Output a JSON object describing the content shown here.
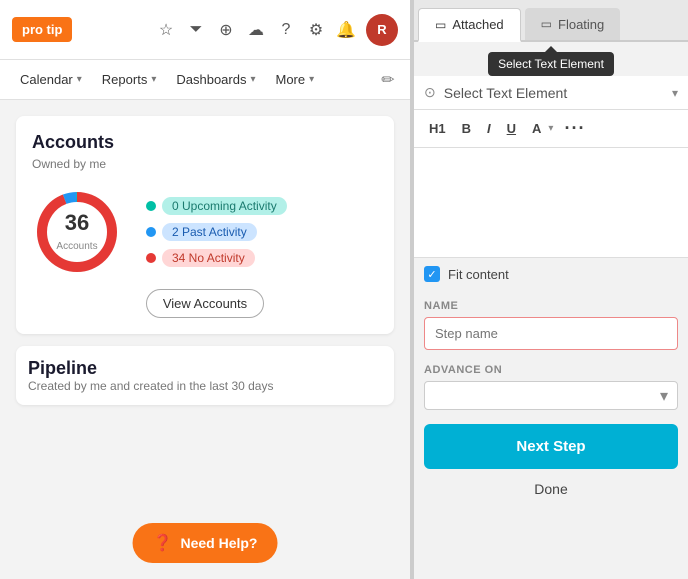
{
  "left": {
    "pro_tip_label": "pro tip",
    "nav_items": [
      {
        "label": "Calendar",
        "id": "calendar"
      },
      {
        "label": "Reports",
        "id": "reports"
      },
      {
        "label": "Dashboards",
        "id": "dashboards"
      },
      {
        "label": "More",
        "id": "more"
      }
    ],
    "accounts": {
      "title": "Accounts",
      "subtitle": "Owned by me",
      "count": "36",
      "count_label": "Accounts",
      "legend": [
        {
          "color": "#00bfa5",
          "badge_class": "badge-teal",
          "text": "0 Upcoming Activity"
        },
        {
          "color": "#2196f3",
          "badge_class": "badge-blue",
          "text": "2 Past Activity"
        },
        {
          "color": "#e53935",
          "badge_class": "badge-red",
          "text": "34 No Activity"
        }
      ],
      "view_accounts_label": "View Accounts"
    },
    "pipeline": {
      "title": "Pipeline",
      "subtitle": "Created by me and created in the last 30 days"
    },
    "need_help_label": "Need Help?"
  },
  "right": {
    "tabs": [
      {
        "label": "Attached",
        "id": "attached",
        "active": true,
        "icon": "▭"
      },
      {
        "label": "Floating",
        "id": "floating",
        "active": false,
        "icon": "▭"
      }
    ],
    "tooltip_text": "Select Text Element",
    "select_placeholder": "Select Text Element",
    "format": {
      "h1": "H1",
      "bold": "B",
      "italic": "I",
      "underline": "U",
      "color": "A",
      "more": "···"
    },
    "fit_content_label": "Fit content",
    "name_label": "NAME",
    "step_name_placeholder": "Step name",
    "advance_on_label": "ADVANCE ON",
    "next_step_label": "Next Step",
    "done_label": "Done"
  }
}
